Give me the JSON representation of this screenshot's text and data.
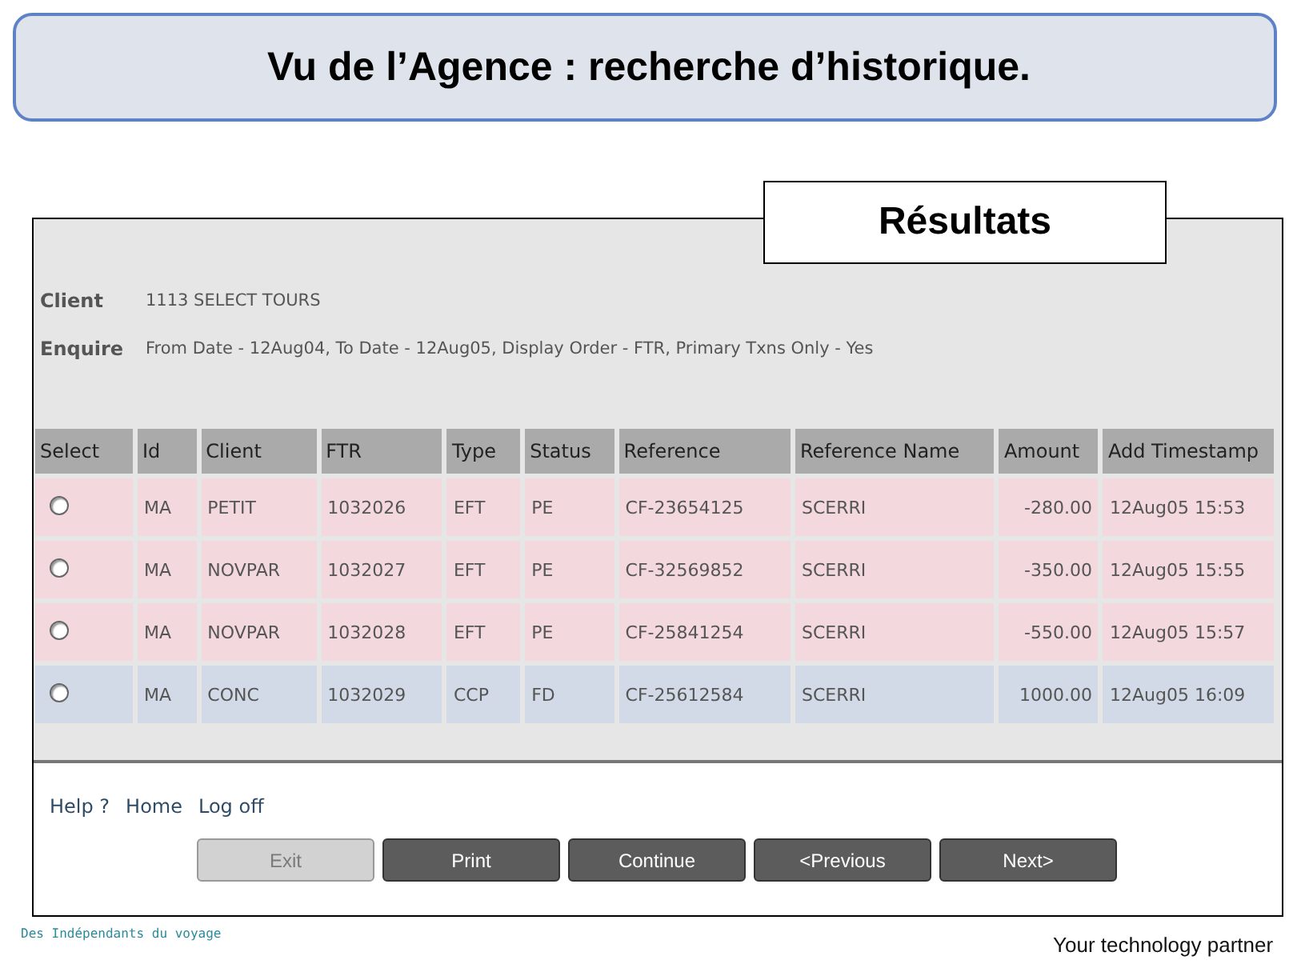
{
  "title": "Vu de l’Agence : recherche d’historique.",
  "results_label": "Résultats",
  "client": {
    "label": "Client",
    "value": "1113 SELECT TOURS"
  },
  "enquire": {
    "label": "Enquire",
    "value": "From Date - 12Aug04, To Date - 12Aug05, Display Order - FTR, Primary Txns Only - Yes"
  },
  "table": {
    "columns": [
      "Select",
      "Id",
      "Client",
      "FTR",
      "Type",
      "Status",
      "Reference",
      "Reference Name",
      "Amount",
      "Add Timestamp"
    ],
    "rows": [
      {
        "selected": false,
        "color": "#f3d9dd",
        "cells": [
          "",
          "MA",
          "PETIT",
          "1032026",
          "EFT",
          "PE",
          "CF-23654125",
          "SCERRI",
          "-280.00",
          "12Aug05 15:53"
        ]
      },
      {
        "selected": false,
        "color": "#f3d9dd",
        "cells": [
          "",
          "MA",
          "NOVPAR",
          "1032027",
          "EFT",
          "PE",
          "CF-32569852",
          "SCERRI",
          "-350.00",
          "12Aug05 15:55"
        ]
      },
      {
        "selected": false,
        "color": "#f3d9dd",
        "cells": [
          "",
          "MA",
          "NOVPAR",
          "1032028",
          "EFT",
          "PE",
          "CF-25841254",
          "SCERRI",
          "-550.00",
          "12Aug05 15:57"
        ]
      },
      {
        "selected": false,
        "color": "#d1dae6",
        "cells": [
          "",
          "MA",
          "CONC",
          "1032029",
          "CCP",
          "FD",
          "CF-25612584",
          "SCERRI",
          "1000.00",
          "12Aug05 16:09"
        ]
      }
    ]
  },
  "links": [
    "Help ?",
    "Home",
    "Log off"
  ],
  "buttons": [
    {
      "label": "Exit",
      "disabled": true
    },
    {
      "label": "Print",
      "disabled": false
    },
    {
      "label": "Continue",
      "disabled": false
    },
    {
      "label": "<Previous",
      "disabled": false
    },
    {
      "label": "Next>",
      "disabled": false
    }
  ],
  "footer_left": "Des Indépendants du voyage",
  "footer_right": "Your technology partner"
}
